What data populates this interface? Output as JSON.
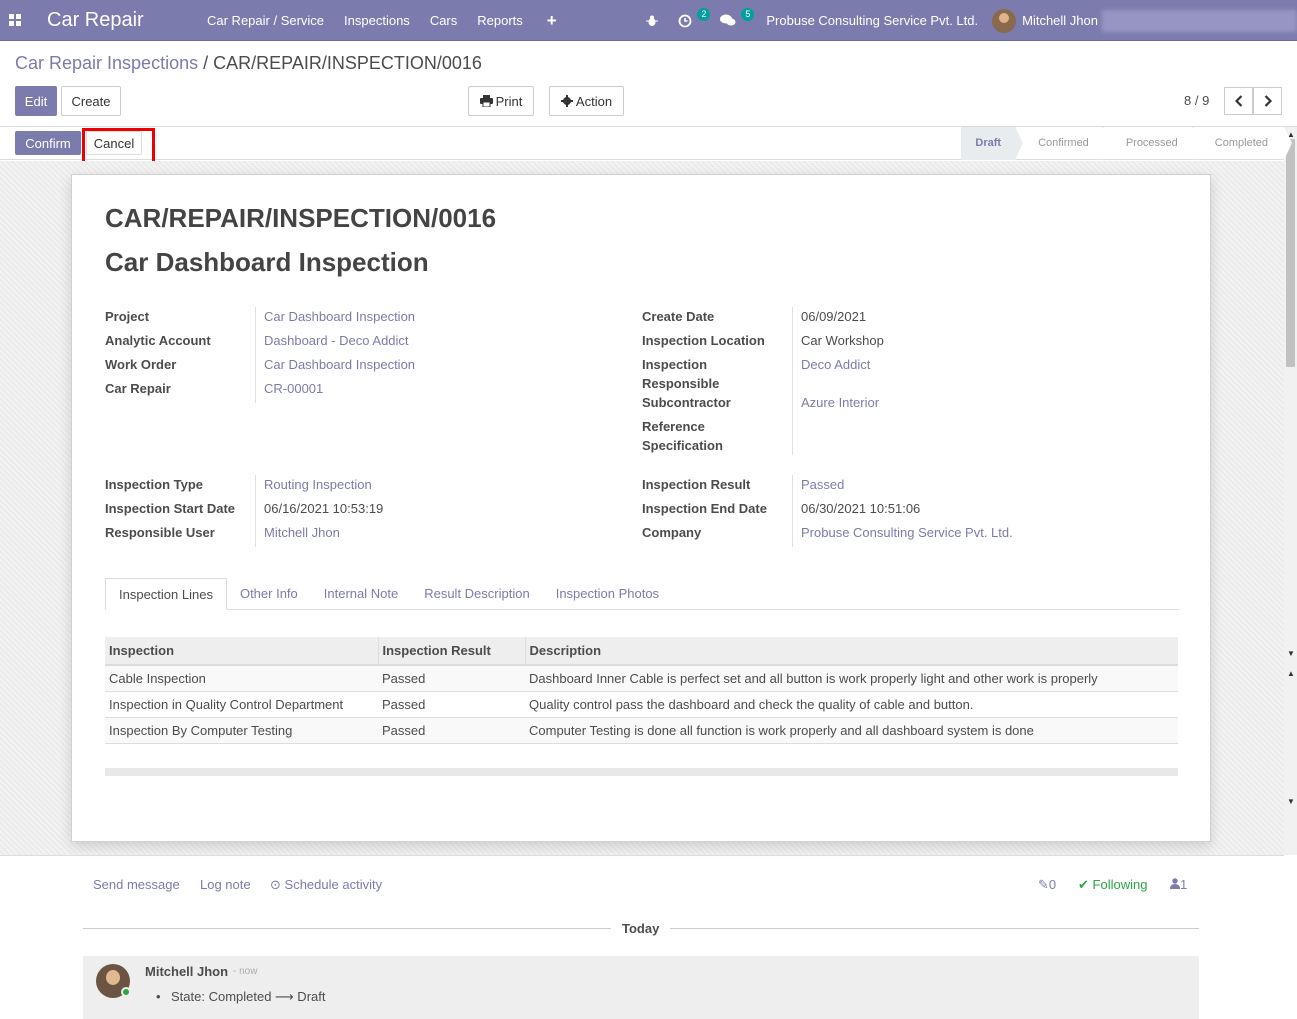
{
  "navbar": {
    "brand": "Car Repair",
    "menu": [
      "Car Repair / Service",
      "Inspections",
      "Cars",
      "Reports"
    ],
    "activity_count": "2",
    "message_count": "5",
    "company": "Probuse Consulting Service Pvt. Ltd.",
    "user": "Mitchell Jhon"
  },
  "breadcrumb": {
    "parent": "Car Repair Inspections",
    "separator": "/",
    "current": "CAR/REPAIR/INSPECTION/0016"
  },
  "buttons": {
    "edit": "Edit",
    "create": "Create",
    "print": "Print",
    "action": "Action",
    "confirm": "Confirm",
    "cancel": "Cancel"
  },
  "pager": {
    "value": "8 / 9"
  },
  "stages": [
    {
      "label": "Draft",
      "active": true
    },
    {
      "label": "Confirmed",
      "active": false
    },
    {
      "label": "Processed",
      "active": false
    },
    {
      "label": "Completed",
      "active": false
    }
  ],
  "record": {
    "reference": "CAR/REPAIR/INSPECTION/0016",
    "name": "Car Dashboard Inspection",
    "left_group": [
      {
        "label": "Project",
        "value": "Car Dashboard Inspection"
      },
      {
        "label": "Analytic Account",
        "value": "Dashboard - Deco Addict"
      },
      {
        "label": "Work Order",
        "value": "Car Dashboard Inspection"
      },
      {
        "label": "Car Repair",
        "value": "CR-00001"
      }
    ],
    "right_group": [
      {
        "label": "Create Date",
        "value": "06/09/2021"
      },
      {
        "label": "Inspection Location",
        "value": "Car Workshop"
      },
      {
        "label": "Inspection Responsible",
        "value": "Deco Addict"
      },
      {
        "label": "Subcontractor",
        "value": "Azure Interior"
      },
      {
        "label": "Reference Specification",
        "value": ""
      }
    ],
    "left_group2": [
      {
        "label": "Inspection Type",
        "value": "Routing Inspection"
      },
      {
        "label": "Inspection Start Date",
        "value": "06/16/2021 10:53:19"
      },
      {
        "label": "Responsible User",
        "value": "Mitchell Jhon"
      }
    ],
    "right_group2": [
      {
        "label": "Inspection Result",
        "value": "Passed"
      },
      {
        "label": "Inspection End Date",
        "value": "06/30/2021 10:51:06"
      },
      {
        "label": "Company",
        "value": "Probuse Consulting Service Pvt. Ltd."
      }
    ]
  },
  "tabs": [
    "Inspection Lines",
    "Other Info",
    "Internal Note",
    "Result Description",
    "Inspection Photos"
  ],
  "lines": {
    "headers": [
      "Inspection",
      "Inspection Result",
      "Description"
    ],
    "rows": [
      [
        "Cable Inspection",
        "Passed",
        "Dashboard Inner Cable is perfect set and all button is work properly light and other work is properly"
      ],
      [
        "Inspection in Quality Control Department",
        "Passed",
        "Quality control pass the dashboard and check the quality of cable and button."
      ],
      [
        "Inspection By Computer Testing",
        "Passed",
        "Computer Testing is done all function is work properly and all dashboard system is done"
      ]
    ]
  },
  "chatter": {
    "send_message": "Send message",
    "log_note": "Log note",
    "schedule_activity": "Schedule activity",
    "attachments": "0",
    "following": "Following",
    "followers": "1",
    "day": "Today",
    "message": {
      "author": "Mitchell Jhon",
      "time": "- now",
      "change": "State: Completed ⟶ Draft"
    }
  },
  "colors": {
    "brand": "#7c7bad",
    "highlight": "#ee0000",
    "following": "#28a745"
  }
}
